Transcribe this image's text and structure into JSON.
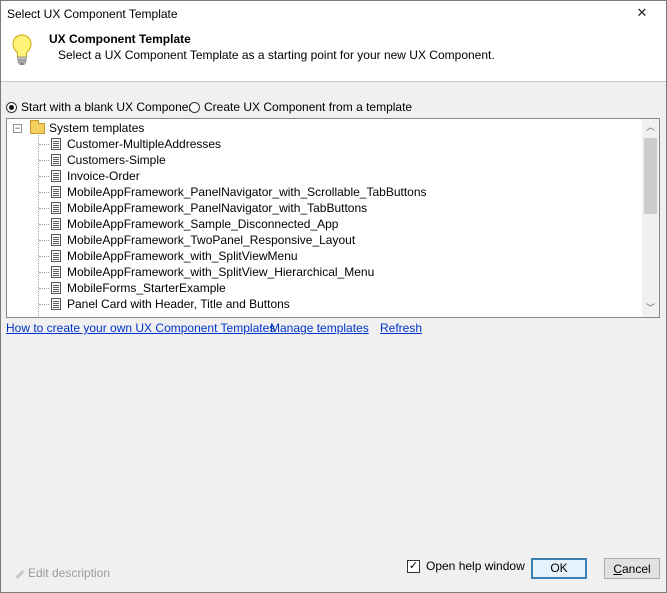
{
  "window": {
    "title": "Select UX Component Template"
  },
  "header": {
    "icon": "lightbulb-icon",
    "title": "UX Component Template",
    "description": "Select a UX Component Template as a starting point for your new UX Component."
  },
  "options": {
    "blank": {
      "label": "Start with a blank UX Component",
      "selected": true
    },
    "from_template": {
      "label": "Create UX Component from a template",
      "selected": false
    }
  },
  "tree": {
    "root_label": "System templates",
    "items": [
      "Customer-MultipleAddresses",
      "Customers-Simple",
      "Invoice-Order",
      "MobileAppFramework_PanelNavigator_with_Scrollable_TabButtons",
      "MobileAppFramework_PanelNavigator_with_TabButtons",
      "MobileAppFramework_Sample_Disconnected_App",
      "MobileAppFramework_TwoPanel_Responsive_Layout",
      "MobileAppFramework_with_SplitViewMenu",
      "MobileAppFramework_with_SplitView_Hierarchical_Menu",
      "MobileForms_StarterExample",
      "Panel Card with Header, Title and Buttons"
    ]
  },
  "links": {
    "how_to": "How to create your own UX Component Templates",
    "manage": "Manage templates",
    "refresh": "Refresh"
  },
  "footer": {
    "edit_description": "Edit description",
    "open_help": {
      "label": "Open help window",
      "checked": true
    },
    "ok_label": "OK",
    "cancel_prefix": "C",
    "cancel_rest": "ancel"
  }
}
